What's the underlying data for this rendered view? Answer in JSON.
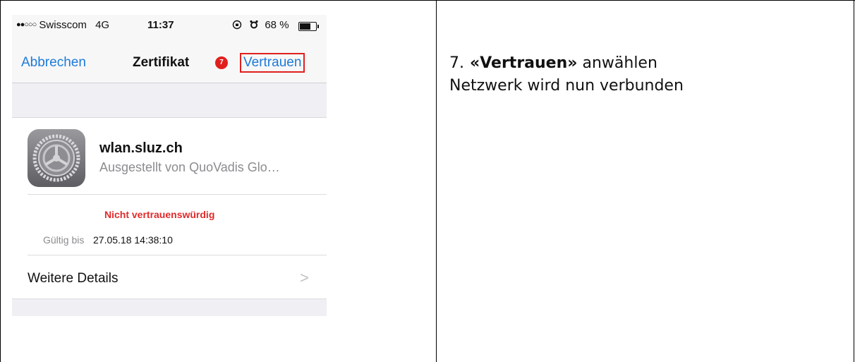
{
  "status_bar": {
    "carrier_dots": "●●○○○",
    "carrier": "Swisscom",
    "network": "4G",
    "time": "11:37",
    "lock_icon": "rotation-lock-icon",
    "alarm_icon": "alarm-icon",
    "battery_text": "68 %",
    "battery_level": 0.68
  },
  "nav": {
    "cancel_label": "Abbrechen",
    "title": "Zertifikat",
    "badge": "7",
    "trust_label": "Vertrauen"
  },
  "certificate": {
    "icon": "settings-gear-icon",
    "name": "wlan.sluz.ch",
    "issuer": "Ausgestellt von QuoVadis Glo…",
    "status": "Nicht vertrauenswürdig",
    "valid_label": "Gültig bis",
    "valid_value": "27.05.18 14:38:10",
    "more_label": "Weitere Details",
    "more_chevron": ">"
  },
  "instruction": {
    "step": "7.",
    "action": "«Vertrauen»",
    "action_suffix": " anwählen",
    "line2": "Netzwerk wird nun verbunden"
  },
  "colors": {
    "ios_blue": "#1d7ad8",
    "alert_red": "#e0201e",
    "bar_gray": "#f7f7f8",
    "group_gray": "#efeff4"
  }
}
